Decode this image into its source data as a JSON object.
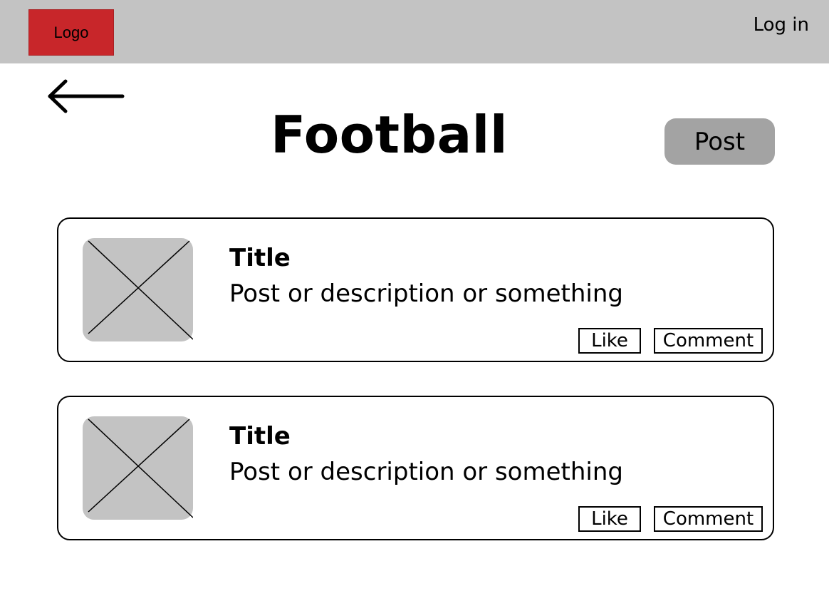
{
  "header": {
    "logo_label": "Logo",
    "login_label": "Log in"
  },
  "page": {
    "title": "Football",
    "post_button_label": "Post",
    "back_icon": "arrow-left-icon"
  },
  "posts": [
    {
      "title": "Title",
      "description": "Post or description or something",
      "image_icon": "image-placeholder-icon",
      "like_label": "Like",
      "comment_label": "Comment"
    },
    {
      "title": "Title",
      "description": "Post or description or something",
      "image_icon": "image-placeholder-icon",
      "like_label": "Like",
      "comment_label": "Comment"
    }
  ],
  "colors": {
    "header_bg": "#c3c3c3",
    "logo_bg": "#c8262a",
    "post_button_bg": "#a3a3a3",
    "placeholder_bg": "#c3c3c3"
  }
}
